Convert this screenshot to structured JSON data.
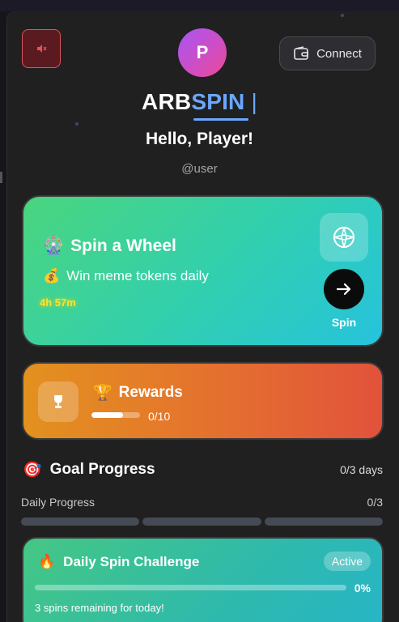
{
  "header": {
    "avatar_initial": "P",
    "connect_label": "Connect",
    "brand_part1": "ARB",
    "brand_part2": "SPIN",
    "brand_cursor": "|",
    "greeting": "Hello, Player!",
    "username": "@user",
    "icons": {
      "mute": "speaker-muted-icon",
      "connect": "wallet-icon"
    }
  },
  "spin_card": {
    "title_emoji": "🎡",
    "title": "Spin a Wheel",
    "subtitle_emoji": "💰",
    "subtitle": "Win meme tokens daily",
    "timer": "4h 57m",
    "button_label": "Spin",
    "icons": {
      "badge": "globe-icon",
      "button": "arrow-right-icon"
    }
  },
  "rewards_card": {
    "title_emoji": "🏆",
    "title": "Rewards",
    "progress_fraction": 0.65,
    "count": "0/10",
    "icons": {
      "badge": "trophy-icon"
    }
  },
  "goal": {
    "emoji": "🎯",
    "title": "Goal Progress",
    "days": "0/3 days",
    "daily_label": "Daily Progress",
    "daily_count": "0/3",
    "segments_total": 3,
    "segments_done": 0
  },
  "challenge": {
    "emoji": "🔥",
    "title": "Daily Spin Challenge",
    "status": "Active",
    "percent": "0%",
    "progress_fraction": 0,
    "remaining": "3 spins remaining for today!"
  },
  "colors": {
    "background": "#202020",
    "brand_accent": "#6aa7ff",
    "spin_gradient_start": "#4ad57e",
    "spin_gradient_end": "#26c3dd",
    "rewards_gradient_start": "#e3911e",
    "rewards_gradient_end": "#e2523b",
    "mute_border": "#e0525a",
    "timer": "#ffe02a"
  }
}
